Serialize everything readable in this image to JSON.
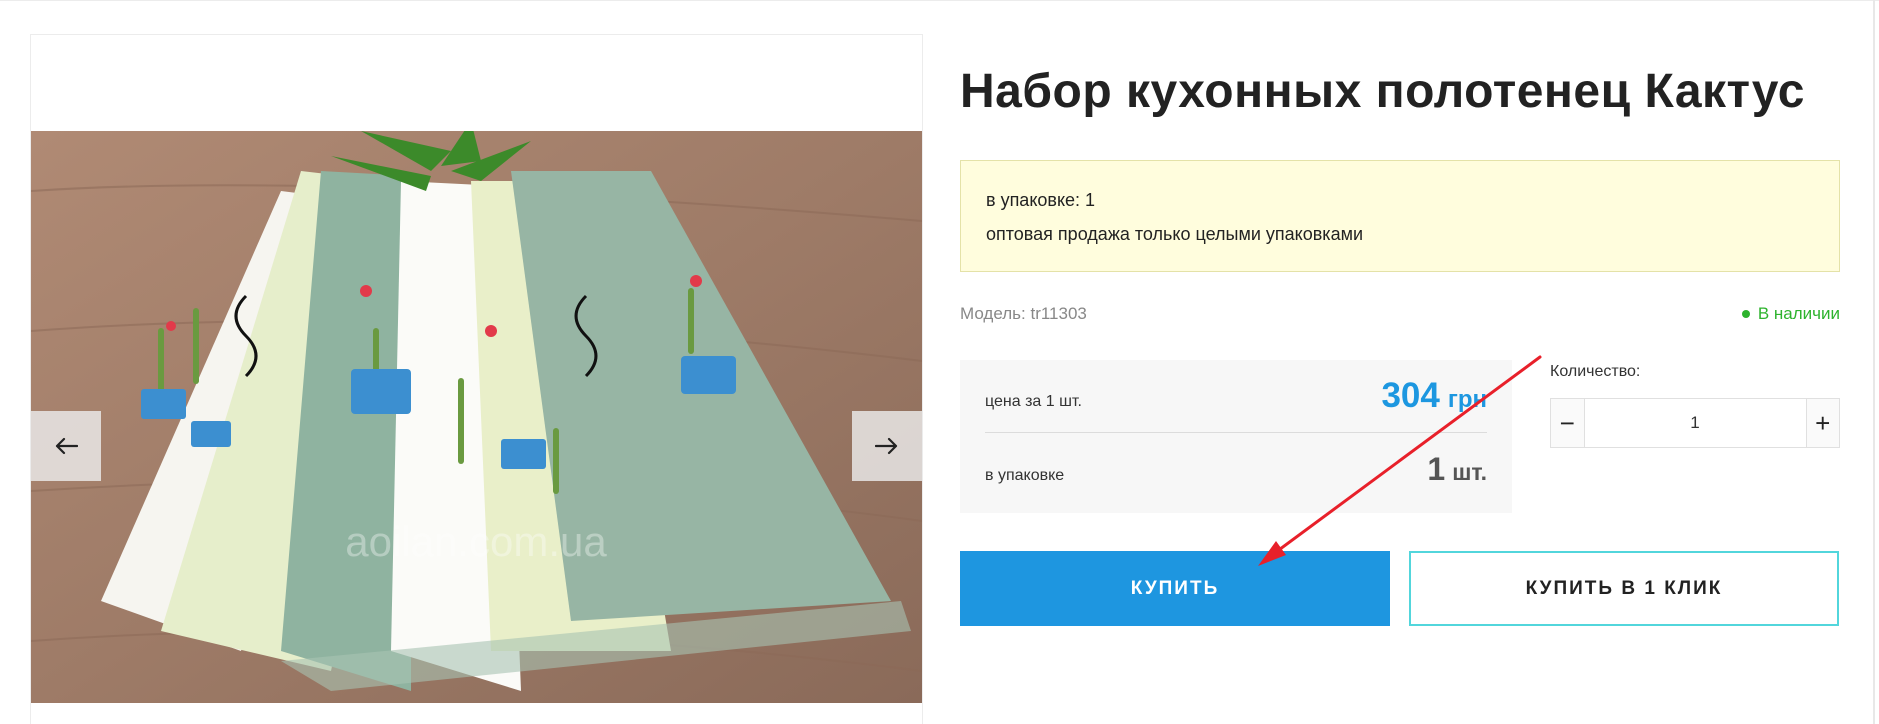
{
  "product": {
    "title": "Набор кухонных полотенец Кактус",
    "pack_info": {
      "line1": "в упаковке: 1",
      "line2": "оптовая продажа только целыми упаковками"
    },
    "model_label": "Модель: tr11303",
    "stock_status": "В наличии",
    "price": {
      "per_unit_label": "цена за 1 шт.",
      "amount": "304",
      "currency": "грн",
      "pack_label": "в упаковке",
      "pack_count": "1",
      "pack_unit": "шт."
    },
    "quantity": {
      "label": "Количество:",
      "value": "1",
      "minus": "−",
      "plus": "+"
    },
    "buttons": {
      "buy": "КУПИТЬ",
      "one_click": "КУПИТЬ В 1 КЛИК"
    }
  },
  "gallery": {
    "watermark": "aoilan.com.ua",
    "prev_icon": "arrow-left-icon",
    "next_icon": "arrow-right-icon"
  },
  "colors": {
    "accent_blue": "#1e96e0",
    "in_stock_green": "#2db32d",
    "notice_bg": "#fffddd",
    "outline_teal": "#52d6dc",
    "annotation_red": "#e8202a"
  }
}
